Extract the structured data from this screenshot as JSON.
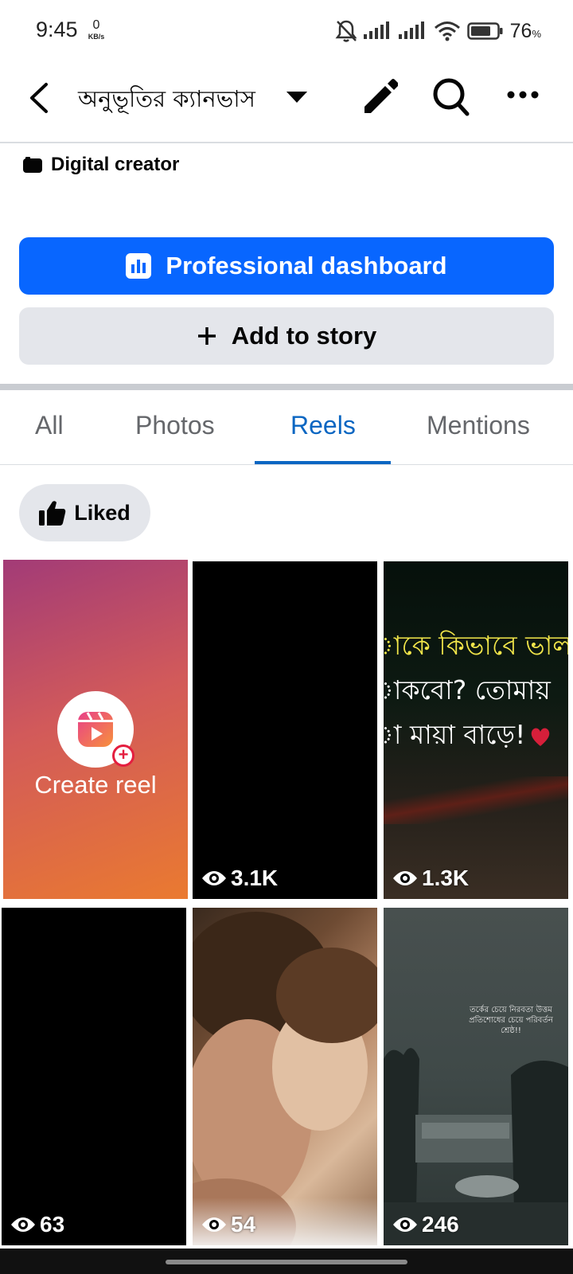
{
  "status_bar": {
    "time": "9:45",
    "net_speed_value": "0",
    "net_speed_unit": "KB/s",
    "battery_percent": "76",
    "battery_suffix": "%"
  },
  "header": {
    "title": "অনুভূতির ক্যানভাস"
  },
  "profile": {
    "category": "Digital creator"
  },
  "buttons": {
    "dashboard": "Professional dashboard",
    "story": "Add to story"
  },
  "tabs": [
    {
      "label": "All",
      "active": false
    },
    {
      "label": "Photos",
      "active": false
    },
    {
      "label": "Reels",
      "active": true
    },
    {
      "label": "Mentions",
      "active": false
    }
  ],
  "filter": {
    "label": "Liked"
  },
  "reels": {
    "create_label": "Create reel",
    "items": [
      {
        "views": "3.1K"
      },
      {
        "views": "1.3K",
        "overlay_text": [
          "াকে কিভাবে ভাল",
          "াকবো? তোমায়",
          "া মায়া বাড়ে!"
        ]
      },
      {
        "views": "63"
      },
      {
        "views": "54"
      },
      {
        "views": "246",
        "overlay_text": "তর্কের চেয়ে নিরবতা উত্তম প্রতিশোধের চেয়ে পরিবর্তন শ্রেষ্ঠ!!"
      }
    ]
  },
  "colors": {
    "accent": "#0866ff",
    "tab_active": "#0a66c2",
    "secondary_button": "#e4e6eb"
  }
}
